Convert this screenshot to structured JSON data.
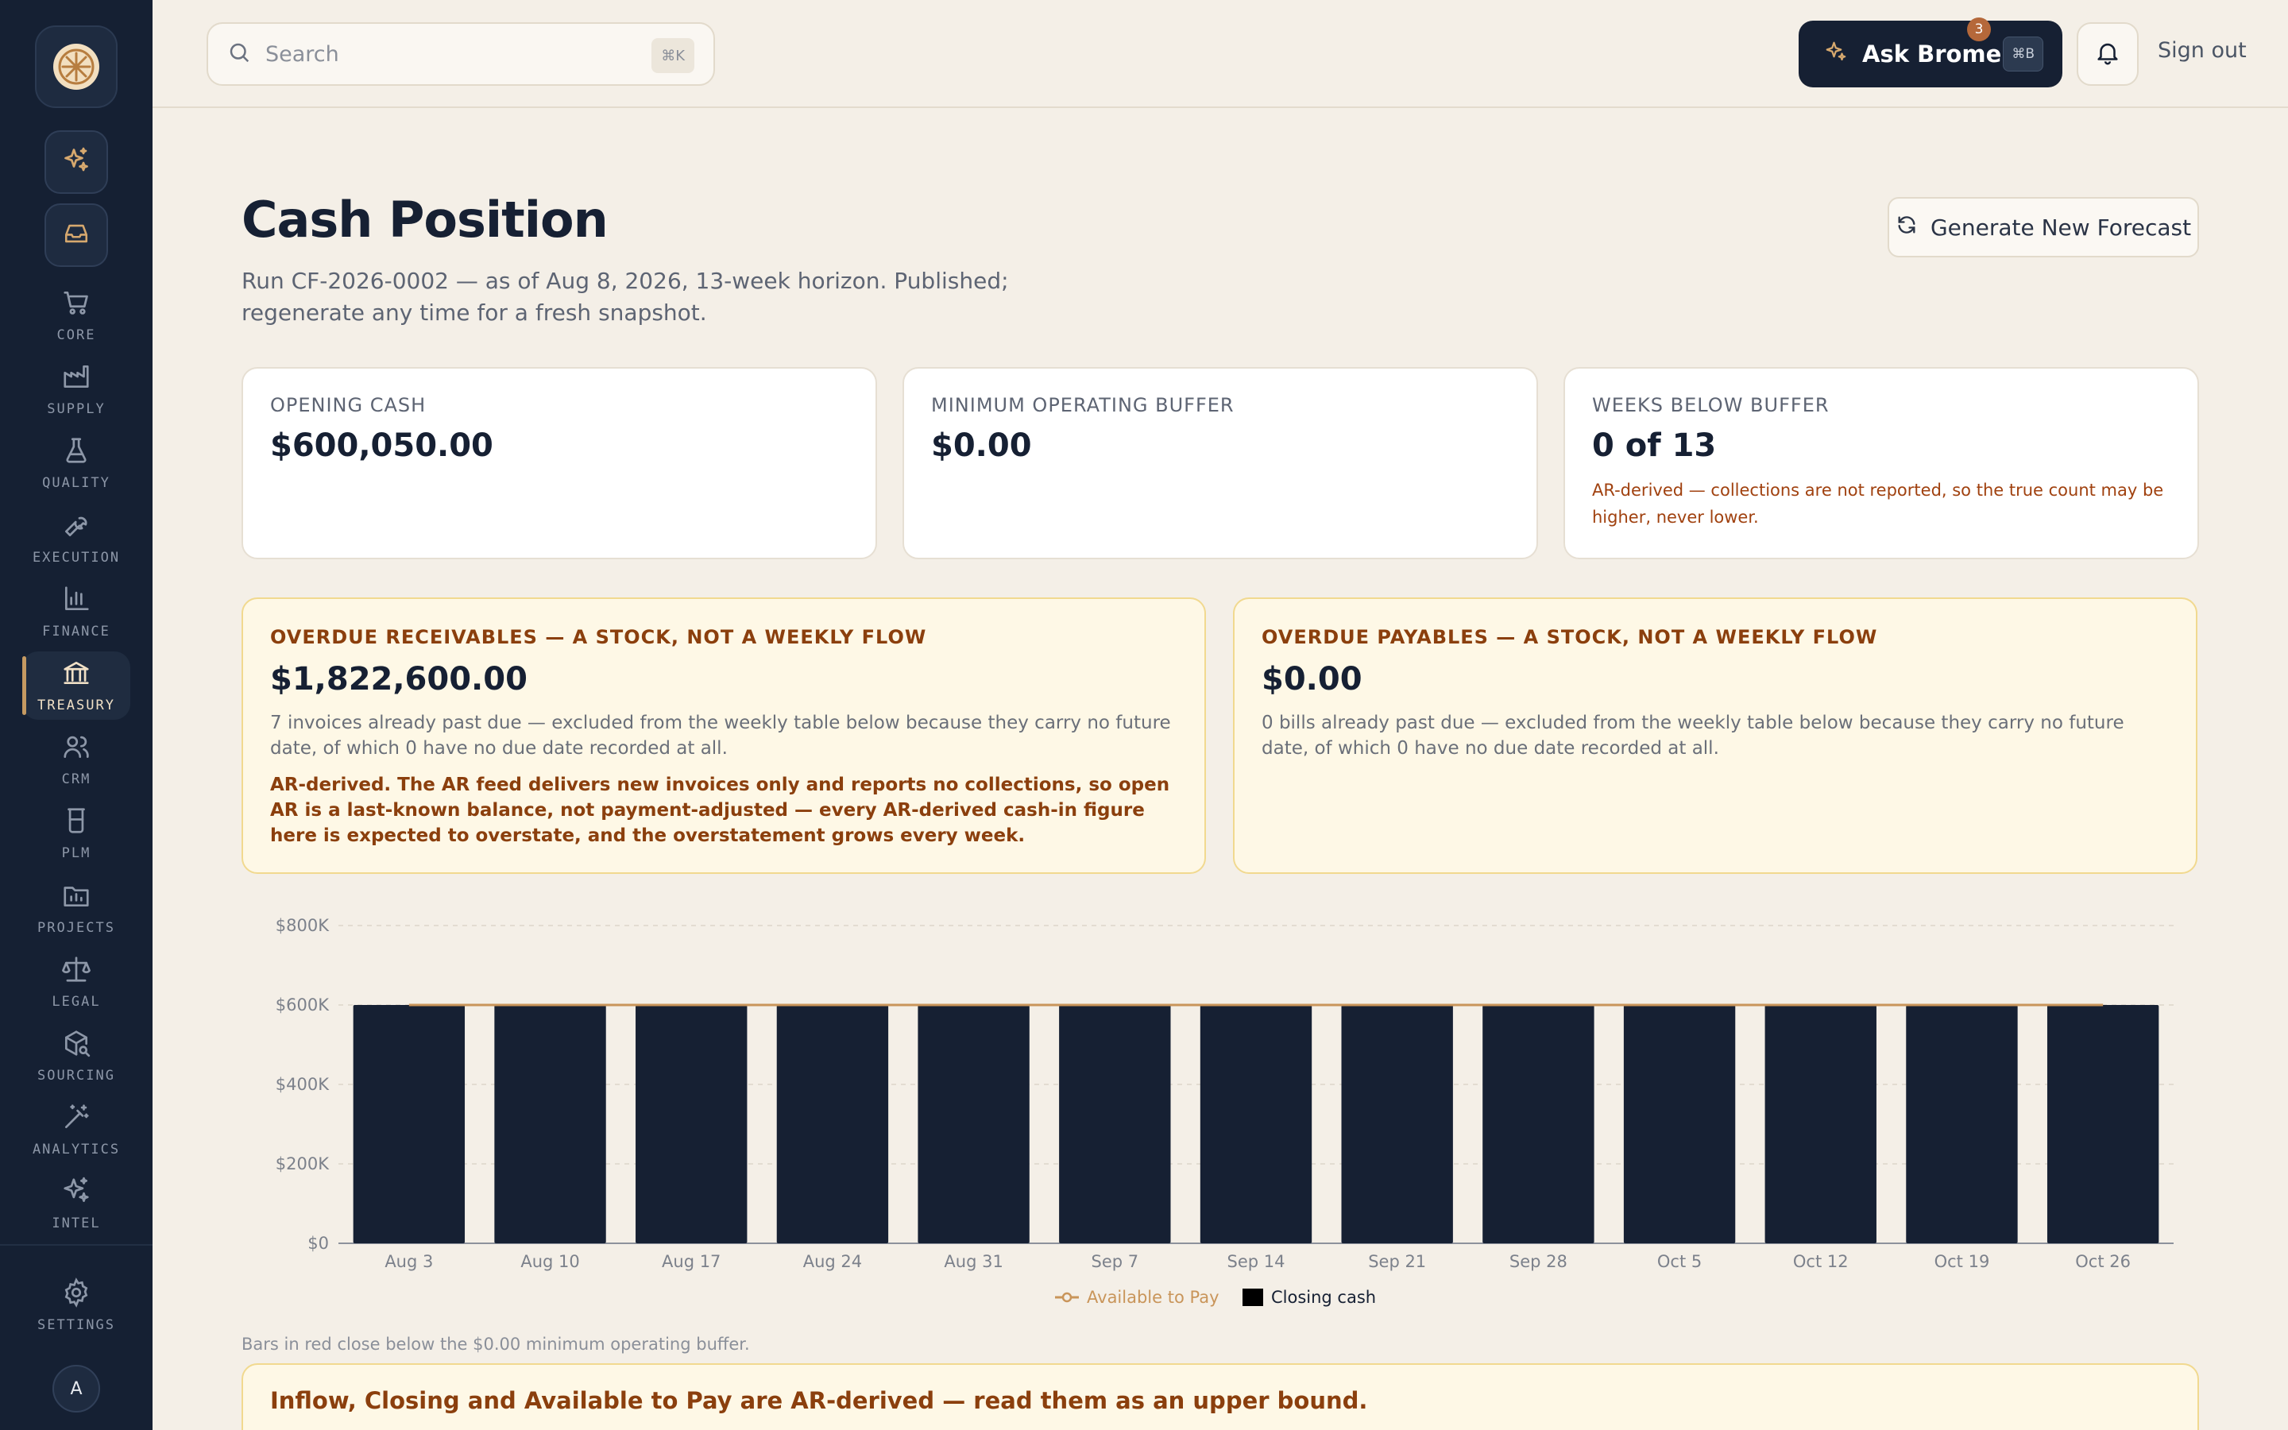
{
  "sidebar": {
    "logo": "bromel-logo-icon",
    "quick": [
      {
        "icon": "sparkles-icon"
      },
      {
        "icon": "inbox-icon"
      }
    ],
    "items": [
      {
        "label": "CORE",
        "icon": "cart-icon"
      },
      {
        "label": "SUPPLY",
        "icon": "factory-icon"
      },
      {
        "label": "QUALITY",
        "icon": "flask-icon"
      },
      {
        "label": "EXECUTION",
        "icon": "wrench-icon"
      },
      {
        "label": "FINANCE",
        "icon": "bar-chart-icon"
      },
      {
        "label": "TREASURY",
        "icon": "bank-icon",
        "active": true
      },
      {
        "label": "CRM",
        "icon": "users-icon"
      },
      {
        "label": "PLM",
        "icon": "beaker-icon"
      },
      {
        "label": "PROJECTS",
        "icon": "folder-icon"
      },
      {
        "label": "LEGAL",
        "icon": "scale-icon"
      },
      {
        "label": "SOURCING",
        "icon": "package-search-icon"
      },
      {
        "label": "ANALYTICS",
        "icon": "magic-wand-icon"
      },
      {
        "label": "INTEL",
        "icon": "sparkles-icon"
      }
    ],
    "settings_label": "SETTINGS",
    "avatar_initial": "A"
  },
  "topbar": {
    "search_placeholder": "Search",
    "search_shortcut": "⌘K",
    "ask_label": "Ask Bromel",
    "ask_shortcut": "⌘B",
    "notifications_count": "3",
    "signout_label": "Sign out"
  },
  "page": {
    "title": "Cash Position",
    "subtitle": "Run CF-2026-0002 — as of Aug 8, 2026, 13-week horizon. Published; regenerate any time for a fresh snapshot.",
    "generate_label": "Generate New Forecast"
  },
  "cards": [
    {
      "caption": "OPENING CASH",
      "value": "$600,050.00",
      "note": ""
    },
    {
      "caption": "MINIMUM OPERATING BUFFER",
      "value": "$0.00",
      "note": ""
    },
    {
      "caption": "WEEKS BELOW BUFFER",
      "value": "0 of 13",
      "note": "AR-derived — collections are not reported, so the true count may be higher, never lower."
    }
  ],
  "overdue": {
    "receivables": {
      "caption": "OVERDUE RECEIVABLES — A STOCK, NOT A WEEKLY FLOW",
      "value": "$1,822,600.00",
      "desc": "7 invoices already past due — excluded from the weekly table below because they carry no future date, of which 0 have no due date recorded at all.",
      "ar_note": "AR-derived. The AR feed delivers new invoices only and reports no collections, so open AR is a last-known balance, not payment-adjusted — every AR-derived cash-in figure here is expected to overstate, and the overstatement grows every week."
    },
    "payables": {
      "caption": "OVERDUE PAYABLES — A STOCK, NOT A WEEKLY FLOW",
      "value": "$0.00",
      "desc": "0 bills already past due — excluded from the weekly table below because they carry no future date, of which 0 have no due date recorded at all."
    }
  },
  "chart_data": {
    "type": "bar",
    "categories": [
      "Aug 3",
      "Aug 10",
      "Aug 17",
      "Aug 24",
      "Aug 31",
      "Sep 7",
      "Sep 14",
      "Sep 21",
      "Sep 28",
      "Oct 5",
      "Oct 12",
      "Oct 19",
      "Oct 26"
    ],
    "series": [
      {
        "name": "Closing cash",
        "type": "bar",
        "color": "#162033",
        "values": [
          600050,
          600050,
          600050,
          600050,
          600050,
          600050,
          600050,
          600050,
          600050,
          600050,
          600050,
          600050,
          600050
        ]
      },
      {
        "name": "Available to Pay",
        "type": "line",
        "color": "#c9955a",
        "values": [
          600050,
          600050,
          600050,
          600050,
          600050,
          600050,
          600050,
          600050,
          600050,
          600050,
          600050,
          600050,
          600050
        ]
      }
    ],
    "yticks": [
      "$0",
      "$200K",
      "$400K",
      "$600K",
      "$800K"
    ],
    "ylim": [
      0,
      800000
    ],
    "grid": true,
    "legend_position": "bottom-center"
  },
  "chart_note": "Bars in red close below the $0.00 minimum operating buffer.",
  "banner": {
    "title": "Inflow, Closing and Available to Pay are AR-derived — read them as an upper bound."
  }
}
